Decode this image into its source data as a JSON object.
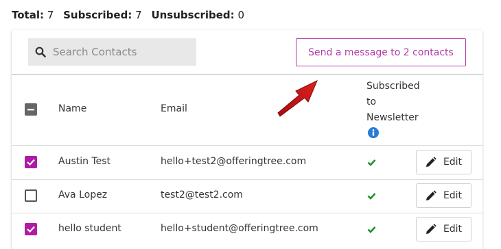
{
  "stats": {
    "total_label": "Total:",
    "total_value": "7",
    "subscribed_label": "Subscribed:",
    "subscribed_value": "7",
    "unsubscribed_label": "Unsubscribed:",
    "unsubscribed_value": "0"
  },
  "search": {
    "placeholder": "Search Contacts",
    "icon": "search-icon"
  },
  "send_button": {
    "label": "Send a message to 2 contacts"
  },
  "annotation": {
    "color": "#cc1111"
  },
  "table": {
    "headers": {
      "name": "Name",
      "email": "Email",
      "subscribed": "Subscribed to Newsletter"
    },
    "rows": [
      {
        "name": "Austin Test",
        "email": "hello+test2@offeringtree.com",
        "checked": true,
        "subscribed": true,
        "edit": "Edit"
      },
      {
        "name": "Ava Lopez",
        "email": "test2@test2.com",
        "checked": false,
        "subscribed": true,
        "edit": "Edit"
      },
      {
        "name": "hello student",
        "email": "hello+student@offeringtree.com",
        "checked": true,
        "subscribed": true,
        "edit": "Edit"
      }
    ]
  },
  "colors": {
    "accent": "#b01aa5",
    "check": "#1f8f2b",
    "info": "#2a7bd4"
  }
}
